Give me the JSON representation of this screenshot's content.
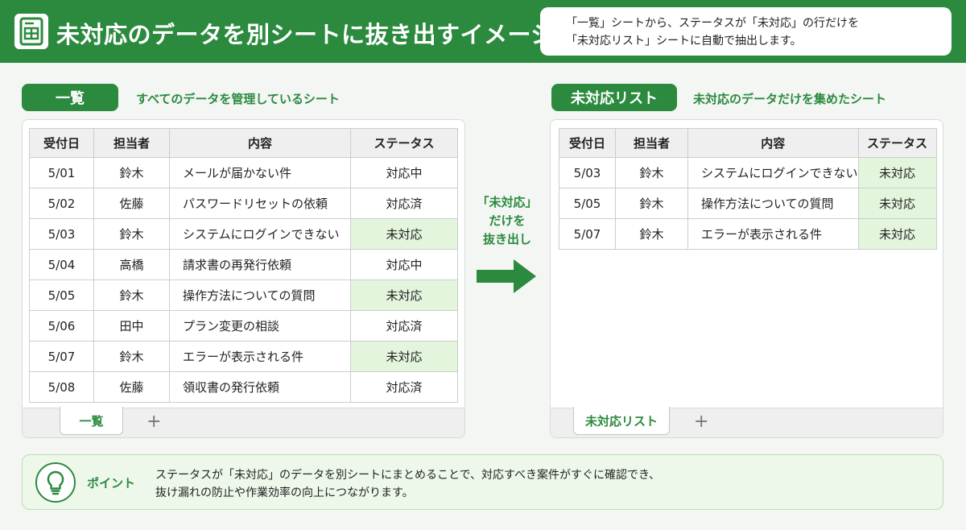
{
  "header": {
    "title": "未対応のデータを別シートに抜き出すイメージ",
    "note_lines": [
      "「一覧」シートから、ステータスが「未対応」の行だけを",
      "「未対応リスト」シートに自動で抽出します。"
    ],
    "icon": "spreadsheet-icon"
  },
  "left": {
    "label": "一覧",
    "description": "すべてのデータを管理しているシート",
    "columns": [
      "受付日",
      "担当者",
      "内容",
      "ステータス"
    ],
    "rows": [
      {
        "date": "5/01",
        "owner": "鈴木",
        "content": "メールが届かない件",
        "status": "対応中",
        "highlight": false
      },
      {
        "date": "5/02",
        "owner": "佐藤",
        "content": "パスワードリセットの依頼",
        "status": "対応済",
        "highlight": false
      },
      {
        "date": "5/03",
        "owner": "鈴木",
        "content": "システムにログインできない",
        "status": "未対応",
        "highlight": true
      },
      {
        "date": "5/04",
        "owner": "高橋",
        "content": "請求書の再発行依頼",
        "status": "対応中",
        "highlight": false
      },
      {
        "date": "5/05",
        "owner": "鈴木",
        "content": "操作方法についての質問",
        "status": "未対応",
        "highlight": true
      },
      {
        "date": "5/06",
        "owner": "田中",
        "content": "プラン変更の相談",
        "status": "対応済",
        "highlight": false
      },
      {
        "date": "5/07",
        "owner": "鈴木",
        "content": "エラーが表示される件",
        "status": "未対応",
        "highlight": true
      },
      {
        "date": "5/08",
        "owner": "佐藤",
        "content": "領収書の発行依頼",
        "status": "対応済",
        "highlight": false
      }
    ],
    "tab": "一覧",
    "add_tab": "+"
  },
  "middle": {
    "lines": [
      "「未対応」",
      "だけを",
      "抜き出し"
    ],
    "icon": "right-arrow-icon"
  },
  "right": {
    "label": "未対応リスト",
    "description": "未対応のデータだけを集めたシート",
    "columns": [
      "受付日",
      "担当者",
      "内容",
      "ステータス"
    ],
    "rows": [
      {
        "date": "5/03",
        "owner": "鈴木",
        "content": "システムにログインできない",
        "status": "未対応",
        "highlight": true
      },
      {
        "date": "5/05",
        "owner": "鈴木",
        "content": "操作方法についての質問",
        "status": "未対応",
        "highlight": true
      },
      {
        "date": "5/07",
        "owner": "鈴木",
        "content": "エラーが表示される件",
        "status": "未対応",
        "highlight": true
      }
    ],
    "tab": "未対応リスト",
    "add_tab": "+"
  },
  "point": {
    "label": "ポイント",
    "icon": "lightbulb-icon",
    "lines": [
      "ステータスが「未対応」のデータを別シートにまとめることで、対応すべき案件がすぐに確認でき、",
      "抜け漏れの防止や作業効率の向上につながります。"
    ]
  },
  "colors": {
    "brand_green": "#2b8a3e",
    "highlight": "#e3f5dc",
    "background": "#f3f6f3"
  }
}
